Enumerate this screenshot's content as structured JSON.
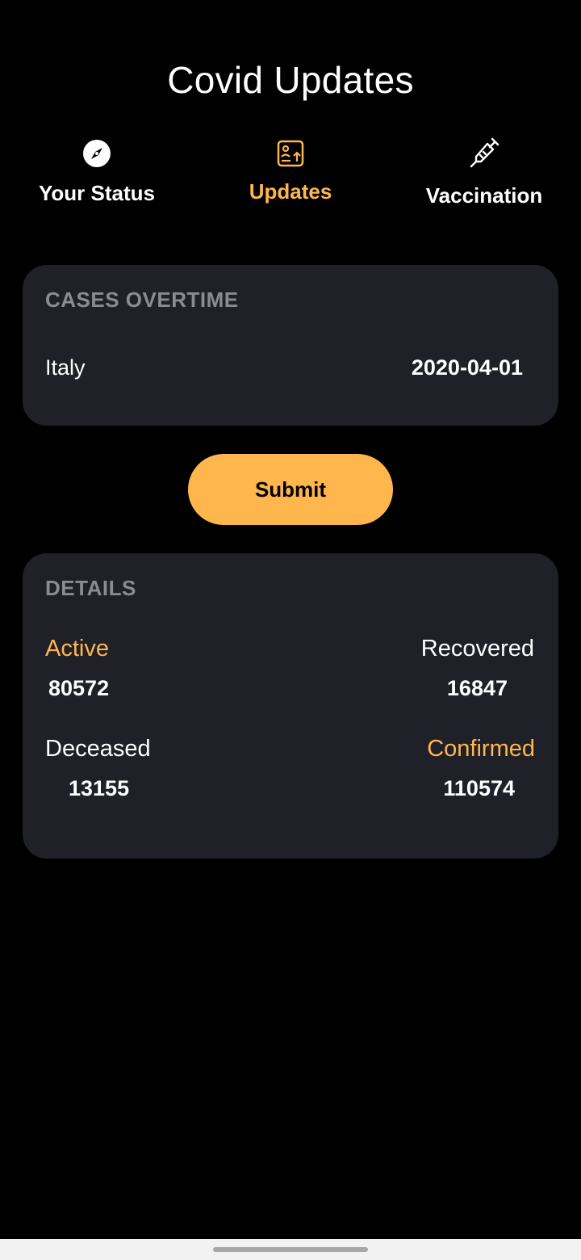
{
  "app": {
    "title": "Covid Updates"
  },
  "nav": {
    "items": [
      {
        "label": "Your Status",
        "icon": "compass-icon",
        "active": false
      },
      {
        "label": "Updates",
        "icon": "document-upload-icon",
        "active": true
      },
      {
        "label": "Vaccination",
        "icon": "syringe-icon",
        "active": false
      }
    ]
  },
  "cases_card": {
    "heading": "CASES OVERTIME",
    "country": "Italy",
    "date": "2020-04-01"
  },
  "submit": {
    "label": "Submit"
  },
  "details_card": {
    "heading": "DETAILS",
    "active": {
      "label": "Active",
      "value": "80572"
    },
    "recovered": {
      "label": "Recovered",
      "value": "16847"
    },
    "deceased": {
      "label": "Deceased",
      "value": "13155"
    },
    "confirmed": {
      "label": "Confirmed",
      "value": "110574"
    }
  },
  "colors": {
    "background": "#000000",
    "card": "#1f2028",
    "accent": "#ffb74d",
    "heading_muted": "#8b8c92",
    "text": "#ffffff"
  }
}
